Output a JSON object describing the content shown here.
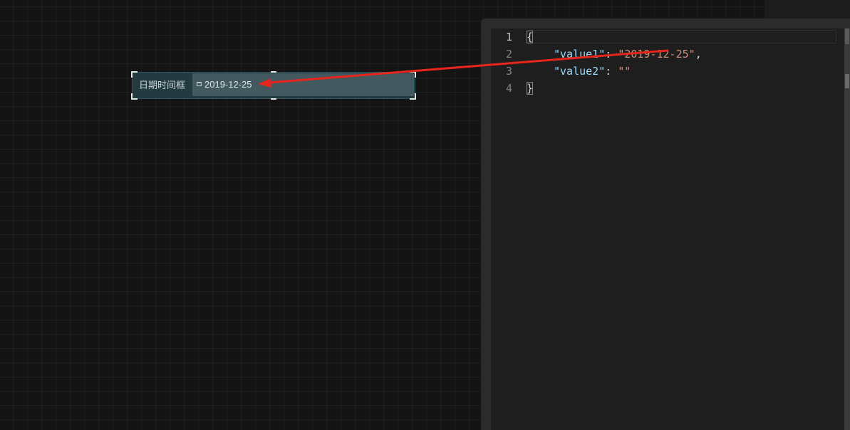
{
  "widget": {
    "label": "日期时间框",
    "date_value": "2019-12-25"
  },
  "editor": {
    "line_numbers": [
      "1",
      "2",
      "3",
      "4"
    ],
    "lines": {
      "open_brace": "{",
      "key1": "\"value1\"",
      "sep1": ": ",
      "val1": "\"2019-12-25\"",
      "comma1": ",",
      "key2": "\"value2\"",
      "sep2": ": ",
      "val2": "\"\"",
      "close_brace": "}"
    }
  },
  "annotation": {
    "arrow_color": "#e8251c"
  },
  "colors": {
    "canvas_bg": "#141414",
    "widget_bg": "#233a40",
    "date_field_bg": "#435960",
    "editor_bg": "#1e1e1e",
    "json_key": "#9cdcfe",
    "json_string": "#ce9178"
  }
}
